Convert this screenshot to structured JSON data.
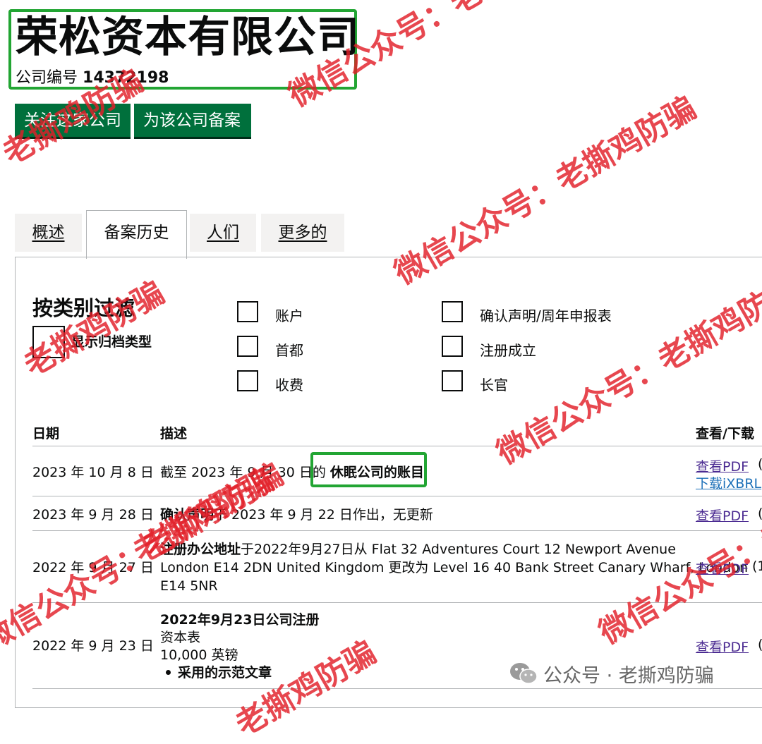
{
  "company": {
    "name": "荣松资本有限公司",
    "number_label": "公司编号",
    "number": "14372198"
  },
  "actions": {
    "follow": "关注这家公司",
    "file": "为该公司备案"
  },
  "tabs": [
    {
      "label": "概述",
      "active": false
    },
    {
      "label": "备案历史",
      "active": true
    },
    {
      "label": "人们",
      "active": false
    },
    {
      "label": "更多的",
      "active": false
    }
  ],
  "filter": {
    "title": "按类别过滤",
    "show_types": "显示归档类型",
    "options": [
      "账户",
      "首都",
      "收费",
      "确认声明/周年申报表",
      "注册成立",
      "长官"
    ]
  },
  "table": {
    "headers": {
      "date": "日期",
      "description": "描述",
      "view": "查看/下载"
    },
    "rows": [
      {
        "date": "2023 年 10 月 8 日",
        "desc_prefix": "截至 2023 年 9 月 30 日的",
        "desc_bold": "休眠公司的账目",
        "links": [
          "查看PDF",
          "下载iXBRL"
        ],
        "paren": "("
      },
      {
        "date": "2023 年 9 月 28 日",
        "desc_bold": "确认声明",
        "desc_rest": "于 2023 年 9 月 22 日作出，无更新",
        "links": [
          "查看PDF"
        ],
        "paren": "("
      },
      {
        "date": "2022 年 9 月 27 日",
        "desc_bold": "注册办公地址",
        "desc_line1": "于2022年9月27日从 Flat 32 Adventures Court 12 Newport Avenue",
        "desc_line2": "London E14 2DN United Kingdom 更改为 Level 16 40 Bank Street Canary Wharf, London",
        "desc_line3": "E14 5NR",
        "links": [
          "查看PDF"
        ],
        "paren": "(1"
      },
      {
        "date": "2022 年 9 月 23 日",
        "desc_bold": "2022年9月23日公司注册",
        "desc_line1": "资本表",
        "desc_line2": "10,000 英镑",
        "desc_bullet": "采用的示范文章",
        "links": [
          "查看PDF"
        ],
        "paren": "("
      }
    ]
  },
  "watermarks": {
    "wechat": "微信公众号：老撕鸡防骗",
    "anti_scam": "老撕鸡防骗",
    "footer": "公众号 · 老撕鸡防骗"
  },
  "colors": {
    "button_green": "#00703c",
    "highlight_green": "#22a533",
    "watermark_red": "#e21e28",
    "link_purple": "#4c2c92",
    "link_blue": "#1d70b8"
  }
}
